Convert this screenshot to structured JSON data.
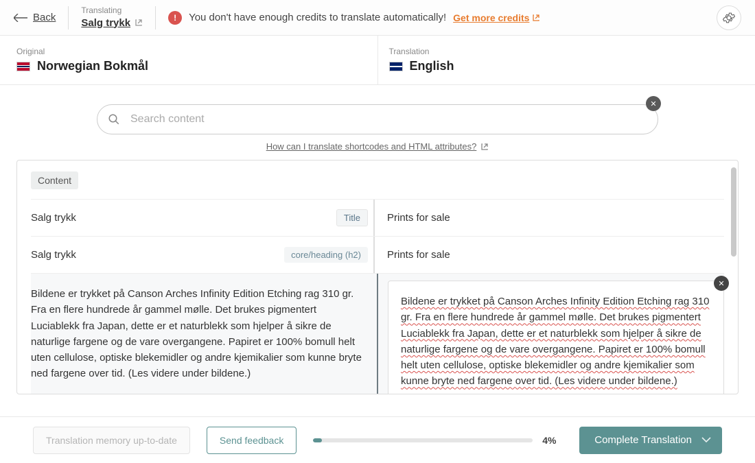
{
  "topbar": {
    "back_label": "Back",
    "translating_label": "Translating",
    "translating_title": "Salg trykk",
    "warning_text": "You don't have enough credits to translate automatically!",
    "credits_link": "Get more credits"
  },
  "languages": {
    "original_label": "Original",
    "original_name": "Norwegian Bokmål",
    "translation_label": "Translation",
    "translation_name": "English"
  },
  "search": {
    "placeholder": "Search content",
    "help_link": "How can I translate shortcodes and HTML attributes?"
  },
  "content": {
    "tab_label": "Content",
    "rows": [
      {
        "orig": "Salg trykk",
        "trans": "Prints for sale",
        "badge": "Title"
      },
      {
        "orig": "Salg trykk",
        "trans": "Prints for sale",
        "badge": "core/heading (h2)"
      }
    ],
    "active_orig": "Bildene er trykket på Canson Arches Infinity Edition Etching rag 310 gr. Fra en flere hundrede år gammel mølle. Det brukes pigmentert Luciablekk fra Japan, dette er et naturblekk som hjelper å sikre de naturlige fargene og de vare overgangene. Papiret er 100% bomull helt uten cellulose, optiske blekemidler og andre kjemikalier som kunne bryte ned fargene over tid. (Les videre under bildene.)",
    "active_trans": "Bildene er trykket på Canson Arches Infinity Edition Etching rag 310 gr. Fra en flere hundrede år gammel mølle. Det brukes pigmentert Luciablekk fra Japan, dette er et naturblekk som hjelper å sikre de naturlige fargene og de vare overgangene. Papiret er 100% bomull helt uten cellulose, optiske blekemidler og andre kjemikalier som kunne bryte ned fargene over tid. (Les videre under bildene.)"
  },
  "bottom": {
    "memory_label": "Translation memory up-to-date",
    "feedback_label": "Send feedback",
    "progress_pct": "4%",
    "progress_fill_width": "4%",
    "complete_label": "Complete Translation"
  }
}
